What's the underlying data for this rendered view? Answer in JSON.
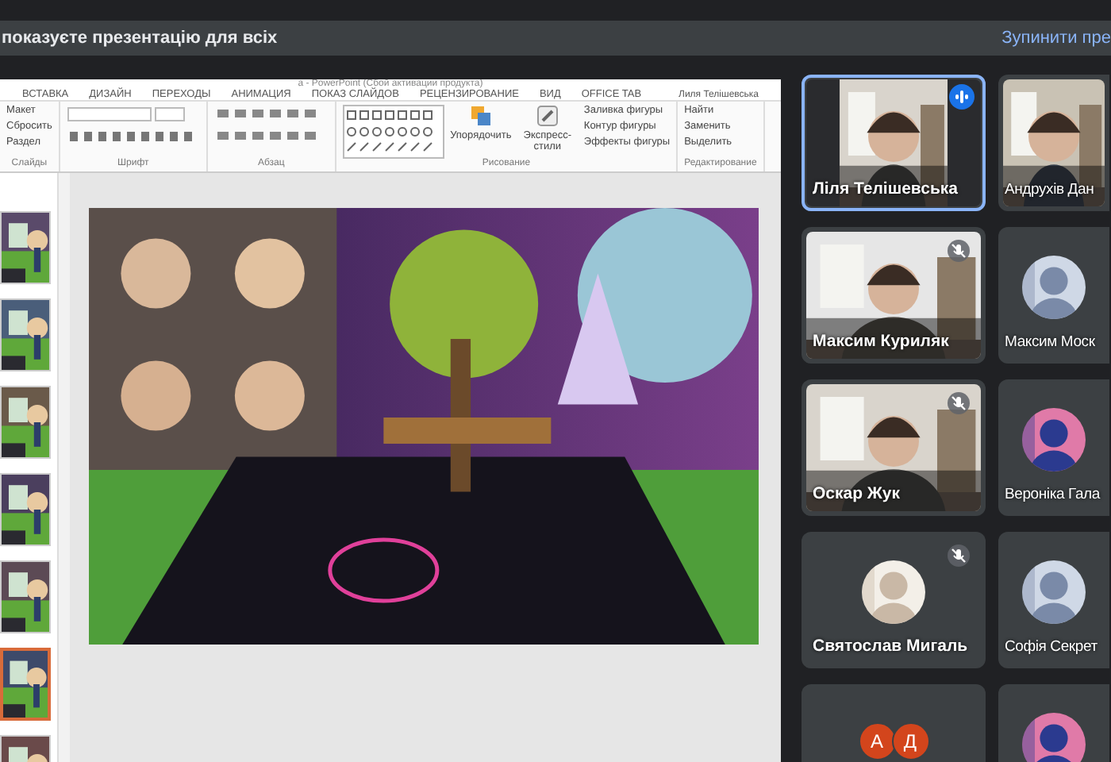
{
  "banner": {
    "message": "показуєте презентацію для всіх",
    "stop_button": "Зупинити пре"
  },
  "powerpoint": {
    "title": "a - PowerPoint (Сбой активации продукта)",
    "user": "Лиля Телішевська",
    "tabs": [
      "ВСТАВКА",
      "ДИЗАЙН",
      "ПЕРЕХОДЫ",
      "АНИМАЦИЯ",
      "ПОКАЗ СЛАЙДОВ",
      "РЕЦЕНЗИРОВАНИЕ",
      "ВИД",
      "OFFICE TAB"
    ],
    "groups": [
      {
        "kind": "slides",
        "label": "Слайды",
        "commands": [
          "Макет",
          "Сбросить",
          "Раздел"
        ]
      },
      {
        "kind": "font",
        "label": "Шрифт"
      },
      {
        "kind": "paragraph",
        "label": "Абзац"
      },
      {
        "kind": "drawing",
        "label": "Рисование",
        "big_commands": [
          "Упорядочить",
          "Экспресс-стили"
        ],
        "commands": [
          "Заливка фигуры",
          "Контур фигуры",
          "Эффекты фигуры"
        ]
      },
      {
        "kind": "editing",
        "label": "Редактирование",
        "commands": [
          "Найти",
          "Заменить",
          "Выделить"
        ]
      }
    ],
    "thumbnails": [
      {
        "selected": false
      },
      {
        "selected": false
      },
      {
        "selected": false
      },
      {
        "selected": false
      },
      {
        "selected": false
      },
      {
        "selected": true
      },
      {
        "selected": false
      }
    ]
  },
  "participants": [
    {
      "name": "Ліля Телішевська",
      "kind": "video",
      "speaking": true,
      "muted": false
    },
    {
      "name": "Андрухів Дан",
      "kind": "video",
      "speaking": false,
      "muted": false
    },
    {
      "name": "Максим Куриляк",
      "kind": "video",
      "speaking": false,
      "muted": true
    },
    {
      "name": "Максим Моск",
      "kind": "avatar",
      "speaking": false,
      "muted": false
    },
    {
      "name": "Оскар Жук",
      "kind": "video",
      "speaking": false,
      "muted": true
    },
    {
      "name": "Вероніка Гала",
      "kind": "avatar",
      "speaking": false,
      "muted": false
    },
    {
      "name": "Святослав Мигаль",
      "kind": "avatar",
      "speaking": false,
      "muted": true
    },
    {
      "name": "Софія Секрет",
      "kind": "avatar",
      "speaking": false,
      "muted": false
    },
    {
      "kind": "initials",
      "initials": [
        "А",
        "Д"
      ],
      "speaking": false,
      "muted": false
    },
    {
      "kind": "avatar",
      "speaking": false,
      "muted": false
    }
  ]
}
